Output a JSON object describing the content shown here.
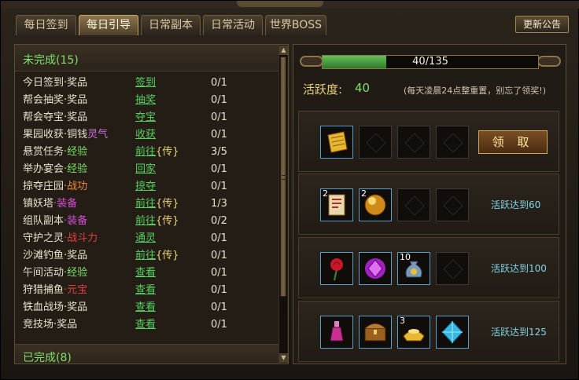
{
  "tabs": [
    {
      "label": "每日签到",
      "active": false
    },
    {
      "label": "每日引导",
      "active": true
    },
    {
      "label": "日常副本",
      "active": false
    },
    {
      "label": "日常活动",
      "active": false
    },
    {
      "label": "世界BOSS",
      "active": false
    }
  ],
  "notice_button": "更新公告",
  "incomplete_header": "未完成(15)",
  "completed_header": "已完成(8)",
  "tasks": [
    {
      "name": "今日签到",
      "reward": "·奖品",
      "reward_color": "#e8e0cc",
      "action": "签到",
      "action_tag": "",
      "count": "0/1"
    },
    {
      "name": "帮会抽奖",
      "reward": "·奖品",
      "reward_color": "#e8e0cc",
      "action": "抽奖",
      "action_tag": "",
      "count": "0/1"
    },
    {
      "name": "帮会夺宝",
      "reward": "·奖品",
      "reward_color": "#e8e0cc",
      "action": "夺宝",
      "action_tag": "",
      "count": "0/1"
    },
    {
      "name": "果园收获",
      "reward": "·铜钱",
      "reward_color": "#e8e0cc",
      "extra": "灵气",
      "extra_color": "#d070e0",
      "action": "收获",
      "action_tag": "",
      "count": "0/1"
    },
    {
      "name": "悬赏任务",
      "reward": "·经验",
      "reward_color": "#7ee06a",
      "action": "前往",
      "action_tag": "{传}",
      "count": "3/5"
    },
    {
      "name": "举办宴会",
      "reward": "·经验",
      "reward_color": "#7ee06a",
      "action": "回家",
      "action_tag": "",
      "count": "0/1"
    },
    {
      "name": "掠夺庄园",
      "reward": "·战功",
      "reward_color": "#f08a3a",
      "action": "掠夺",
      "action_tag": "",
      "count": "0/1"
    },
    {
      "name": "镇妖塔",
      "reward": "·装备",
      "reward_color": "#d050d0",
      "action": "前往",
      "action_tag": "{传}",
      "count": "1/3"
    },
    {
      "name": "组队副本",
      "reward": "·装备",
      "reward_color": "#d050d0",
      "action": "前往",
      "action_tag": "{传}",
      "count": "0/2"
    },
    {
      "name": "守护之灵",
      "reward": "·战斗力",
      "reward_color": "#e04040",
      "action": "通灵",
      "action_tag": "",
      "count": "0/1"
    },
    {
      "name": "沙滩钓鱼",
      "reward": "·奖品",
      "reward_color": "#e8e0cc",
      "action": "前往",
      "action_tag": "{传}",
      "count": "0/1"
    },
    {
      "name": "午间活动",
      "reward": "·经验",
      "reward_color": "#7ee06a",
      "action": "查看",
      "action_tag": "",
      "count": "0/1"
    },
    {
      "name": "狩猎捕鱼",
      "reward": "·元宝",
      "reward_color": "#e04040",
      "action": "查看",
      "action_tag": "",
      "count": "0/1"
    },
    {
      "name": "铁血战场",
      "reward": "·奖品",
      "reward_color": "#e8e0cc",
      "action": "查看",
      "action_tag": "",
      "count": "0/1"
    },
    {
      "name": "竞技场",
      "reward": "·奖品",
      "reward_color": "#e8e0cc",
      "action": "查看",
      "action_tag": "",
      "count": "0/1"
    }
  ],
  "progress": {
    "text": "40/135",
    "value": 40,
    "max": 135
  },
  "activity_label": "活跃度:",
  "activity_value": "40",
  "reset_note": "(每天凌晨24点整重置，别忘了领奖!)",
  "claim_button": "领 取",
  "reward_tiers": [
    {
      "goal": "",
      "items": [
        {
          "icon": "golden-scroll-icon",
          "qty": ""
        },
        {
          "icon": "empty-slot",
          "qty": ""
        },
        {
          "icon": "empty-slot",
          "qty": ""
        },
        {
          "icon": "empty-slot",
          "qty": ""
        }
      ]
    },
    {
      "goal": "活跃达到60",
      "items": [
        {
          "icon": "card-scroll-icon",
          "qty": "2"
        },
        {
          "icon": "golden-orb-icon",
          "qty": "2"
        },
        {
          "icon": "empty-slot",
          "qty": ""
        },
        {
          "icon": "empty-slot",
          "qty": ""
        }
      ]
    },
    {
      "goal": "活跃达到100",
      "items": [
        {
          "icon": "rose-icon",
          "qty": ""
        },
        {
          "icon": "purple-gem-icon",
          "qty": ""
        },
        {
          "icon": "money-bag-icon",
          "qty": "10"
        },
        {
          "icon": "empty-slot",
          "qty": ""
        }
      ]
    },
    {
      "goal": "活跃达到125",
      "items": [
        {
          "icon": "pink-potion-icon",
          "qty": ""
        },
        {
          "icon": "treasure-chest-icon",
          "qty": ""
        },
        {
          "icon": "gold-ingot-icon",
          "qty": "3"
        },
        {
          "icon": "blue-crystal-icon",
          "qty": ""
        }
      ]
    }
  ],
  "colors": {
    "accent_green": "#7ee06a",
    "link_green": "#55d060",
    "gold": "#e8d27a",
    "cyan": "#7fd6e6"
  }
}
